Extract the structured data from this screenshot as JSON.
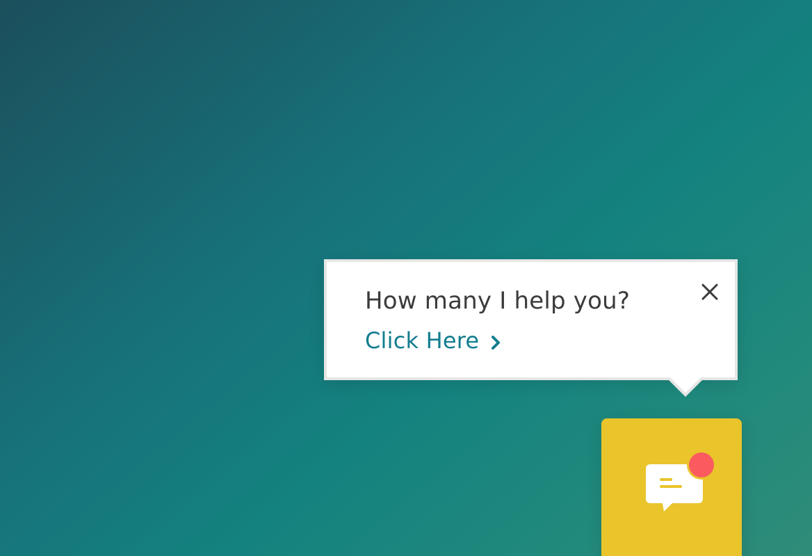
{
  "popover": {
    "title": "How many I help you?",
    "link_label": "Click Here",
    "link_icon": "chevron-right-icon",
    "close_icon": "close-icon"
  },
  "chat_launcher": {
    "icon": "chat-bubble-icon",
    "has_notification": true
  },
  "colors": {
    "background_dark": "#1b4f5c",
    "background_mid": "#14827f",
    "background_light": "#2f8c78",
    "popover_bg": "#ffffff",
    "popover_border": "#e6e6e6",
    "title_text": "#3b3b3b",
    "link_text": "#137d8f",
    "launcher_bg": "#e9c42b",
    "notification": "#fb5b5f"
  }
}
